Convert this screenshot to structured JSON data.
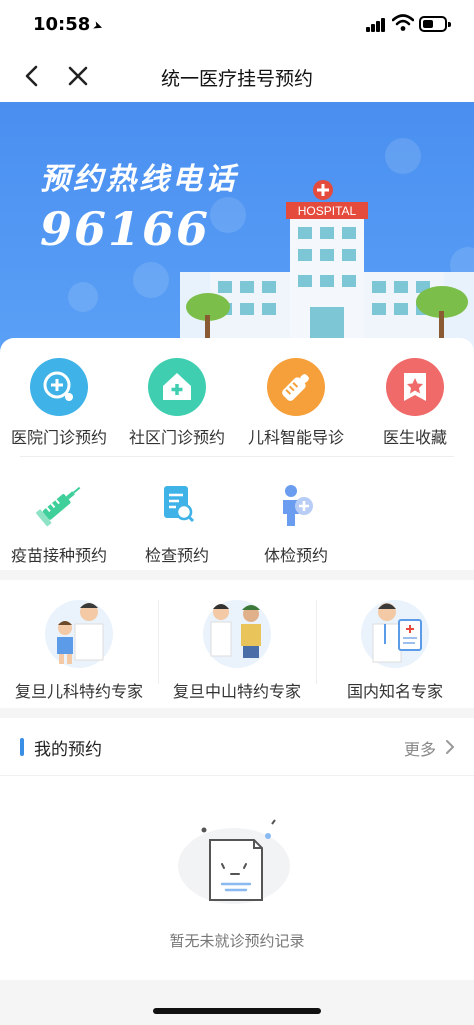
{
  "status_bar": {
    "time": "10:58"
  },
  "nav": {
    "title": "统一医疗挂号预约"
  },
  "banner": {
    "hotline_label": "预约热线电话",
    "phone": "96166",
    "sign_text": "HOSPITAL"
  },
  "services": [
    {
      "label": "医院门诊预约",
      "icon": "hospital-plus-icon",
      "color": "#3fb3e8"
    },
    {
      "label": "社区门诊预约",
      "icon": "home-plus-icon",
      "color": "#3fcfb0"
    },
    {
      "label": "儿科智能导诊",
      "icon": "baby-bottle-icon",
      "color": "#f5a03a"
    },
    {
      "label": "医生收藏",
      "icon": "bookmark-star-icon",
      "color": "#f06a6a"
    },
    {
      "label": "疫苗接种预约",
      "icon": "syringe-icon",
      "color": "#3fcf9a"
    },
    {
      "label": "检查预约",
      "icon": "report-search-icon",
      "color": "#3fb3e8"
    },
    {
      "label": "体检预约",
      "icon": "person-plus-icon",
      "color": "#6a9cf0"
    }
  ],
  "experts": [
    {
      "label": "复旦儿科特约专家"
    },
    {
      "label": "复旦中山特约专家"
    },
    {
      "label": "国内知名专家"
    }
  ],
  "my_appointments": {
    "title": "我的预约",
    "more_label": "更多",
    "empty_text": "暂无未就诊预约记录"
  },
  "colors": {
    "accent": "#3a8ee6",
    "banner": "#4a8ff0"
  }
}
